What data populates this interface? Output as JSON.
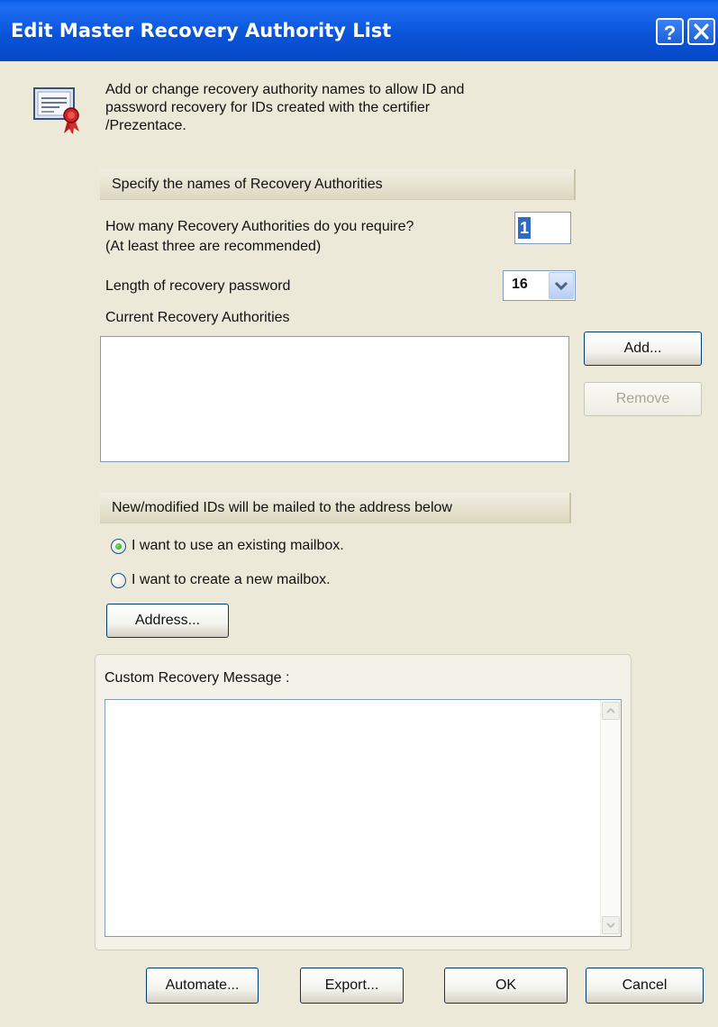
{
  "window": {
    "title": "Edit Master Recovery Authority List",
    "help_button": "?",
    "close_button": "✕"
  },
  "intro": {
    "icon": "certificate-icon",
    "text_line1": "Add or change recovery authority names to allow ID and",
    "text_line2": "password recovery for IDs created with the certifier",
    "text_line3": "/Prezentace."
  },
  "authorities_section": {
    "header": "Specify the names of Recovery Authorities",
    "count_label": "How many Recovery Authorities do you require?",
    "count_hint": "(At least three are recommended)",
    "count_value": "1",
    "password_length_label": "Length of recovery password",
    "password_length_value": "16",
    "current_list_label": "Current Recovery Authorities",
    "add_button": "Add...",
    "remove_button": "Remove"
  },
  "mail_section": {
    "header": "New/modified IDs will be mailed to the address below",
    "option_existing": "I want to use an existing mailbox.",
    "option_new": "I want to create a new mailbox.",
    "selected_option": "existing",
    "address_button": "Address..."
  },
  "custom_message": {
    "label": "Custom Recovery Message :",
    "value": ""
  },
  "footer": {
    "automate_button": "Automate...",
    "export_button": "Export...",
    "ok_button": "OK",
    "cancel_button": "Cancel"
  }
}
